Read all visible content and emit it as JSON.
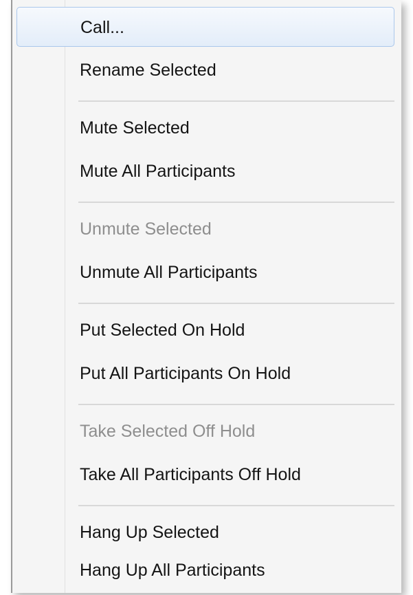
{
  "menu": {
    "groups": [
      {
        "items": [
          {
            "label": "Call...",
            "enabled": true,
            "highlighted": true
          },
          {
            "label": "Rename Selected",
            "enabled": true
          }
        ]
      },
      {
        "items": [
          {
            "label": "Mute Selected",
            "enabled": true
          },
          {
            "label": "Mute All Participants",
            "enabled": true
          }
        ]
      },
      {
        "items": [
          {
            "label": "Unmute Selected",
            "enabled": false
          },
          {
            "label": "Unmute All Participants",
            "enabled": true
          }
        ]
      },
      {
        "items": [
          {
            "label": "Put Selected On Hold",
            "enabled": true
          },
          {
            "label": "Put All Participants On Hold",
            "enabled": true
          }
        ]
      },
      {
        "items": [
          {
            "label": "Take Selected Off Hold",
            "enabled": false
          },
          {
            "label": "Take All Participants Off Hold",
            "enabled": true
          }
        ]
      },
      {
        "items": [
          {
            "label": "Hang Up Selected",
            "enabled": true
          },
          {
            "label": "Hang Up All Participants",
            "enabled": true
          }
        ]
      }
    ],
    "colors": {
      "text": "#141414",
      "disabled_text": "#8e8e8e",
      "highlight_border": "#aac7ec"
    }
  }
}
